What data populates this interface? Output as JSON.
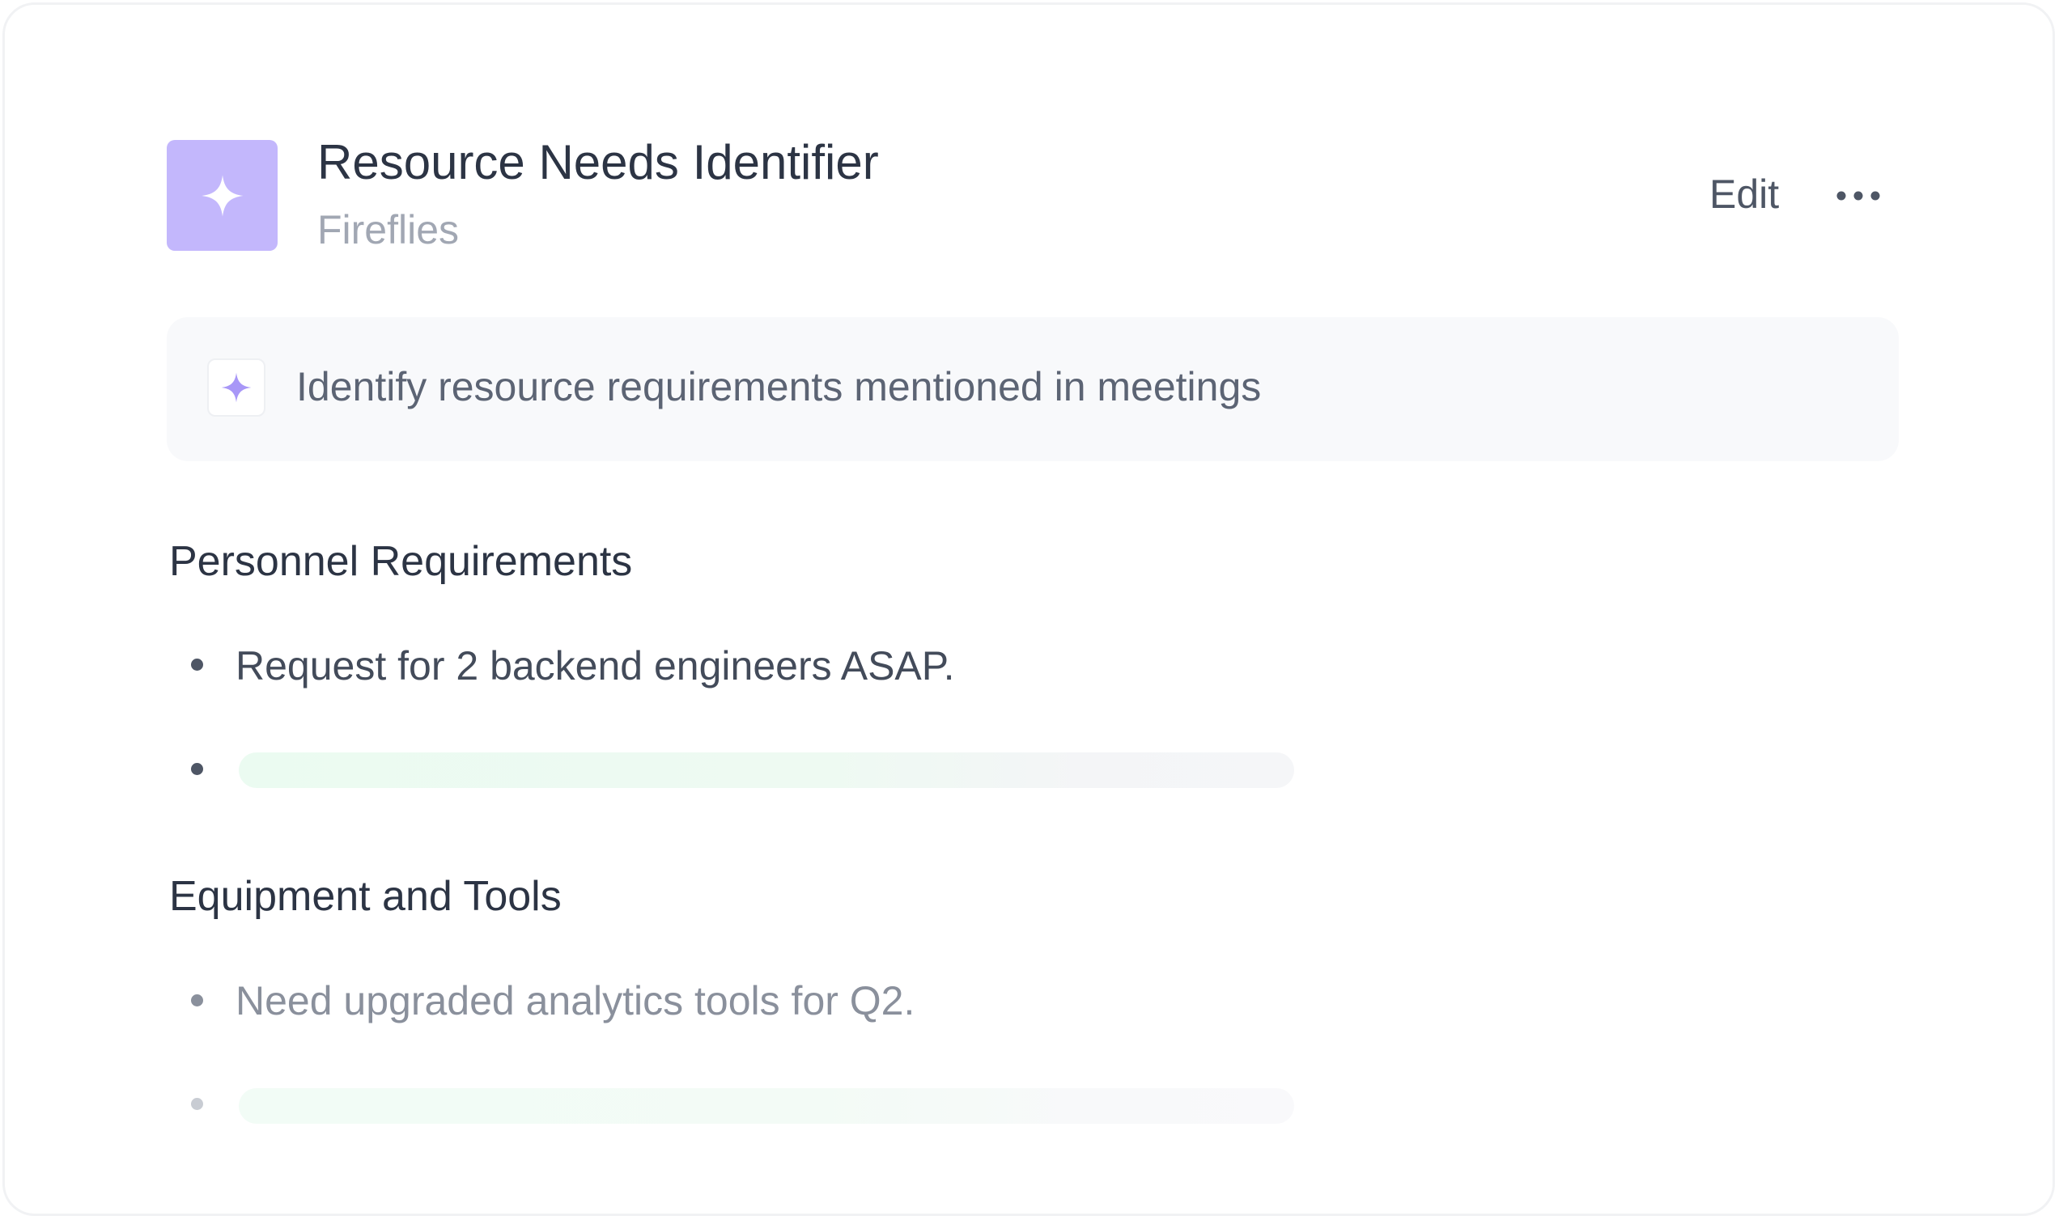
{
  "header": {
    "title": "Resource Needs Identifier",
    "subtitle": "Fireflies",
    "app_icon": "sparkle-icon",
    "edit_label": "Edit",
    "more_icon": "more-horizontal-icon"
  },
  "description": {
    "icon": "sparkle-icon",
    "text": "Identify resource requirements mentioned in meetings"
  },
  "sections": [
    {
      "title": "Personnel Requirements",
      "items": [
        "Request for 2 backend engineers ASAP."
      ]
    },
    {
      "title": "Equipment and Tools",
      "items": [
        "Need upgraded analytics tools for Q2."
      ]
    }
  ],
  "colors": {
    "accent": "#c3b7fc",
    "accent_icon": "#a897f7",
    "heading": "#2c3444",
    "muted": "#a1a7b3",
    "shimmer_green": "#ebfbf1"
  }
}
